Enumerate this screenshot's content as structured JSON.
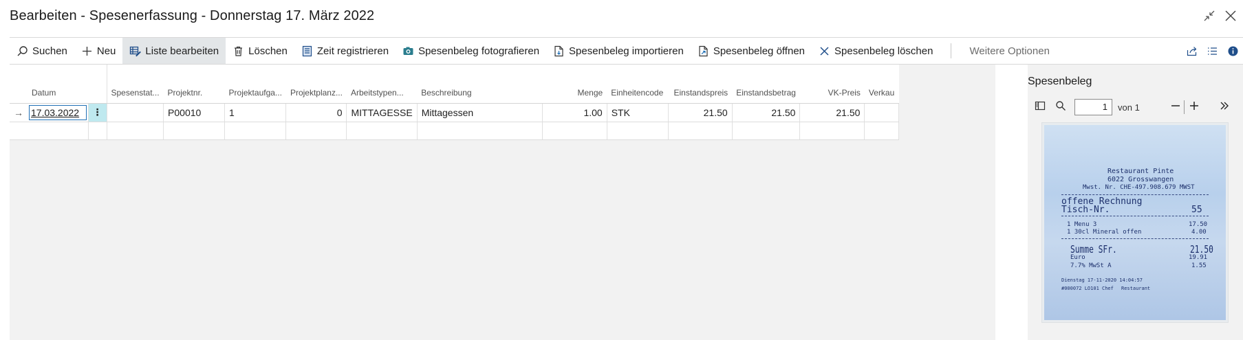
{
  "window": {
    "title": "Bearbeiten - Spesenerfassung - Donnerstag 17. März 2022"
  },
  "actions": [
    {
      "id": "suchen",
      "label": "Suchen",
      "icon": "search-icon"
    },
    {
      "id": "neu",
      "label": "Neu",
      "icon": "plus-icon"
    },
    {
      "id": "liste",
      "label": "Liste bearbeiten",
      "icon": "edit-list-icon",
      "active": true
    },
    {
      "id": "loeschen",
      "label": "Löschen",
      "icon": "trash-icon"
    },
    {
      "id": "zeit",
      "label": "Zeit registrieren",
      "icon": "timesheet-icon"
    },
    {
      "id": "foto",
      "label": "Spesenbeleg fotografieren",
      "icon": "camera-icon"
    },
    {
      "id": "import",
      "label": "Spesenbeleg importieren",
      "icon": "file-import-icon"
    },
    {
      "id": "oeffnen",
      "label": "Spesenbeleg öffnen",
      "icon": "file-open-icon"
    },
    {
      "id": "beleg_loeschen",
      "label": "Spesenbeleg löschen",
      "icon": "x-icon"
    }
  ],
  "more_options": "Weitere Optionen",
  "grid": {
    "columns": [
      "Datum",
      "Spesenstat...",
      "Projektnr.",
      "Projektaufga...",
      "Projektplanz...",
      "Arbeitstypen...",
      "Beschreibung",
      "Menge",
      "Einheitencode",
      "Einstandspreis",
      "Einstandsbetrag",
      "VK-Preis",
      "Verkau"
    ],
    "row": {
      "datum": "17.03.2022",
      "menu": "⋮",
      "status": "",
      "projektnr": "P00010",
      "aufgabe": "1",
      "planzeile": "0",
      "arbeitstyp": "MITTAGESSE",
      "beschreibung": "Mittagessen",
      "menge": "1.00",
      "einheit": "STK",
      "einstandspreis": "21.50",
      "einstandsbetrag": "21.50",
      "vkpreis": "21.50",
      "verkauf": ""
    }
  },
  "sidepanel": {
    "title": "Spesenbeleg",
    "page": "1",
    "page_of": "von 1",
    "receipt": {
      "restaurant": "Restaurant Pinte",
      "address": "6022 Grosswangen",
      "vat": "Mwst. Nr. CHE-497.908.679 MWST",
      "heading": "offene Rechnung",
      "table_label": "Tisch-Nr.",
      "table_no": "55",
      "item1": "1 Menu 3",
      "item1_price": "17.50",
      "item2": "1 30cl Mineral offen",
      "item2_price": "4.00",
      "sum_label": "Summe SFr.",
      "sum": "21.50",
      "euro_label": "Euro",
      "euro": "19.91",
      "vat_label": "7.7% MwSt A",
      "vat_amount": "1.55",
      "footer_date": "Dienstag 17-11-2020 14:04:57",
      "footer_ref": "#000072 LO101 Chef",
      "footer_place": "Restaurant"
    }
  }
}
